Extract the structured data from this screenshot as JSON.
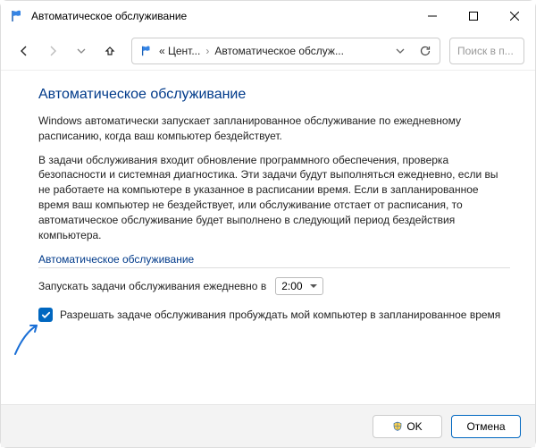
{
  "window": {
    "title": "Автоматическое обслуживание"
  },
  "toolbar": {
    "breadcrumb1": "« Цент...",
    "breadcrumb2": "Автоматическое обслуж...",
    "search_placeholder": "Поиск в п..."
  },
  "content": {
    "heading": "Автоматическое обслуживание",
    "intro": "Windows автоматически запускает запланированное обслуживание по ежедневному расписанию, когда ваш компьютер бездействует.",
    "details": "В задачи обслуживания входит обновление программного обеспечения, проверка безопасности и системная диагностика. Эти задачи будут выполняться ежедневно, если вы не работаете на компьютере в указанное в расписании время. Если в запланированное время ваш компьютер не бездействует, или обслуживание отстает от расписания, то автоматическое обслуживание будет выполнено в следующий период бездействия компьютера.",
    "section_title": "Автоматическое обслуживание",
    "schedule_label": "Запускать задачи обслуживания ежедневно в",
    "schedule_time": "2:00",
    "wake_checkbox_label": "Разрешать задаче обслуживания пробуждать мой компьютер в запланированное время",
    "wake_checked": true
  },
  "footer": {
    "ok": "OK",
    "cancel": "Отмена"
  }
}
